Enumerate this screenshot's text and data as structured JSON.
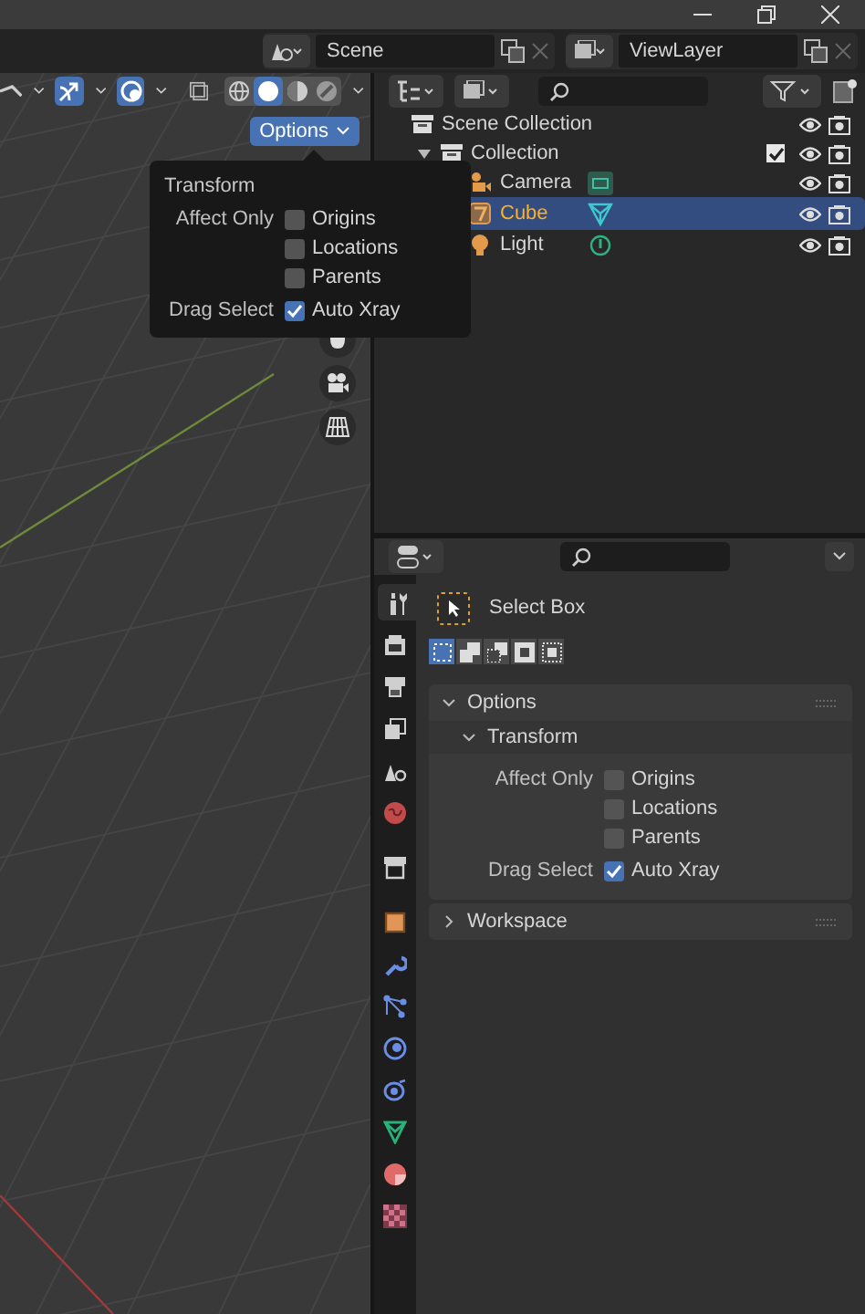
{
  "top_bar": {
    "scene": "Scene",
    "view_layer": "ViewLayer"
  },
  "viewport": {
    "shading_modes": [
      {
        "kind": "wireframe",
        "selected": false
      },
      {
        "kind": "solid",
        "selected": true
      },
      {
        "kind": "material",
        "selected": false
      },
      {
        "kind": "rendered",
        "selected": false
      }
    ],
    "options_button": "Options",
    "popover": {
      "title": "Transform",
      "affect_only_label": "Affect Only",
      "affect_only": [
        {
          "label": "Origins",
          "checked": false
        },
        {
          "label": "Locations",
          "checked": false
        },
        {
          "label": "Parents",
          "checked": false
        }
      ],
      "drag_select_label": "Drag Select",
      "drag_select": {
        "label": "Auto Xray",
        "checked": true
      }
    }
  },
  "outliner": {
    "tree": [
      {
        "name": "Scene Collection",
        "kind": "scene_collection",
        "selected": false,
        "children": [
          {
            "name": "Collection",
            "kind": "collection",
            "selected": false,
            "expanded": true,
            "checked": true,
            "children": [
              {
                "name": "Camera",
                "kind": "camera",
                "selected": false
              },
              {
                "name": "Cube",
                "kind": "mesh",
                "selected": true
              },
              {
                "name": "Light",
                "kind": "light",
                "selected": false
              }
            ]
          }
        ]
      }
    ]
  },
  "properties": {
    "tabs": [
      {
        "kind": "tool",
        "selected": true
      },
      {
        "kind": "render",
        "selected": false
      },
      {
        "kind": "output",
        "selected": false
      },
      {
        "kind": "view_layer",
        "selected": false
      },
      {
        "kind": "scene",
        "selected": false
      },
      {
        "kind": "world",
        "selected": false
      },
      {
        "kind": "collection",
        "selected": false
      },
      {
        "kind": "object",
        "selected": false
      },
      {
        "kind": "modifiers",
        "selected": false
      },
      {
        "kind": "particles",
        "selected": false
      },
      {
        "kind": "physics",
        "selected": false
      },
      {
        "kind": "constraints",
        "selected": false
      },
      {
        "kind": "data",
        "selected": false
      },
      {
        "kind": "material",
        "selected": false
      },
      {
        "kind": "texture",
        "selected": false
      }
    ],
    "tool": "Select Box",
    "select_modes": [
      {
        "kind": "set",
        "selected": true
      },
      {
        "kind": "extend",
        "selected": false
      },
      {
        "kind": "subtract",
        "selected": false
      },
      {
        "kind": "invert",
        "selected": false
      },
      {
        "kind": "intersect",
        "selected": false
      }
    ],
    "options_panel": {
      "title": "Options",
      "expanded": true,
      "transform": {
        "title": "Transform",
        "expanded": true,
        "affect_only_label": "Affect Only",
        "affect_only": [
          {
            "label": "Origins",
            "checked": false
          },
          {
            "label": "Locations",
            "checked": false
          },
          {
            "label": "Parents",
            "checked": false
          }
        ],
        "drag_select_label": "Drag Select",
        "drag_select": {
          "label": "Auto Xray",
          "checked": true
        }
      }
    },
    "workspace_panel": {
      "title": "Workspace",
      "expanded": false
    }
  }
}
